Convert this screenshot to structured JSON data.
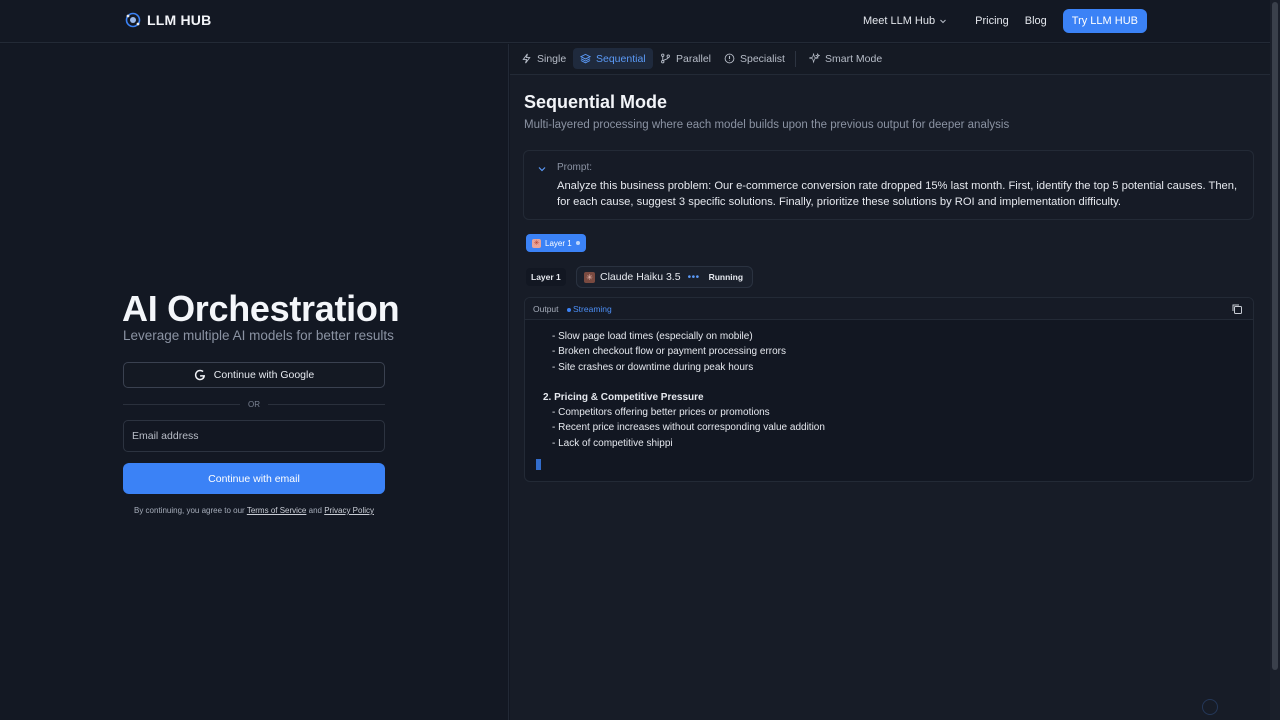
{
  "brand": {
    "name": "LLM HUB"
  },
  "nav": {
    "meet": "Meet LLM Hub",
    "pricing": "Pricing",
    "blog": "Blog",
    "cta": "Try LLM HUB"
  },
  "auth": {
    "title": "AI Orchestration",
    "subtitle": "Leverage multiple AI models for better results",
    "google_button": "Continue with Google",
    "divider": "OR",
    "email_placeholder": "Email address",
    "email_button": "Continue with email",
    "legal_prefix": "By continuing, you agree to our",
    "terms": "Terms of Service",
    "and": "and",
    "privacy": "Privacy Policy"
  },
  "tabs": [
    {
      "label": "Single",
      "icon": "lightning-icon",
      "active": false
    },
    {
      "label": "Sequential",
      "icon": "layers-icon",
      "active": true
    },
    {
      "label": "Parallel",
      "icon": "branch-icon",
      "active": false
    },
    {
      "label": "Specialist",
      "icon": "specialist-icon",
      "active": false
    },
    {
      "label": "Smart Mode",
      "icon": "sparkle-icon",
      "active": false
    }
  ],
  "mode": {
    "title": "Sequential Mode",
    "description": "Multi-layered processing where each model builds upon the previous output for deeper analysis"
  },
  "prompt": {
    "label": "Prompt:",
    "text": "Analyze this business problem: Our e-commerce conversion rate dropped 15% last month. First, identify the top 5 potential causes. Then, for each cause, suggest 3 specific solutions. Finally, prioritize these solutions by ROI and implementation difficulty."
  },
  "layer_chip": {
    "label": "Layer 1"
  },
  "layer_row": {
    "label": "Layer 1",
    "model": "Claude Haiku 3.5",
    "dots": "•••",
    "status": "Running"
  },
  "output": {
    "label": "Output",
    "stream_label": "Streaming",
    "lines": [
      "- Slow page load times (especially on mobile)",
      "- Broken checkout flow or payment processing errors",
      "- Site crashes or downtime during peak hours",
      "",
      "2. Pricing & Competitive Pressure",
      "- Competitors offering better prices or promotions",
      "- Recent price increases without corresponding value addition",
      "- Lack of competitive shippi"
    ]
  },
  "colors": {
    "accent": "#3b82f6",
    "background": "#121722",
    "panel": "#171c27"
  }
}
